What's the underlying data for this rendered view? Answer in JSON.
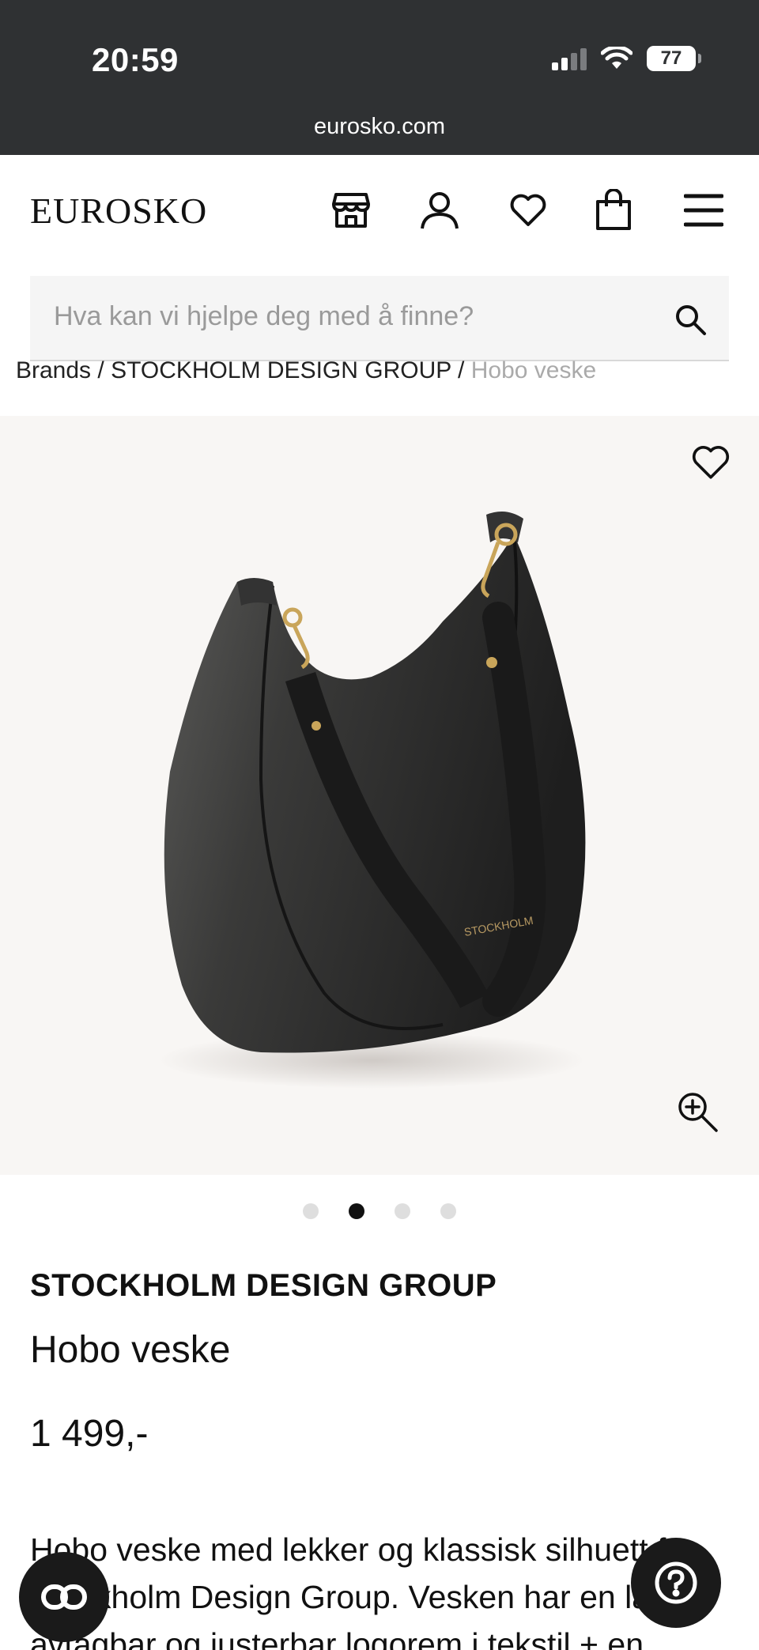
{
  "status_bar": {
    "time": "20:59",
    "battery": "77",
    "url": "eurosko.com"
  },
  "header": {
    "logo": "EUROSKO",
    "icons": [
      "store-icon",
      "user-icon",
      "heart-icon",
      "bag-icon",
      "menu-icon"
    ]
  },
  "search": {
    "placeholder": "Hva kan vi hjelpe deg med å finne?"
  },
  "breadcrumb": {
    "items": [
      "Brands",
      "STOCKHOLM DESIGN GROUP"
    ],
    "current": "Hobo veske",
    "separator": " / "
  },
  "gallery": {
    "slide_count": 4,
    "active_slide": 2,
    "bag_stamp": "STOCKHOLM"
  },
  "product": {
    "brand": "STOCKHOLM DESIGN GROUP",
    "name": "Hobo veske",
    "price": "1 499,-",
    "description": "Hobo veske med lekker og klassisk silhuett fra Stockholm Design Group. Vesken har en lang avtagbar og justerbar logorem i tekstil + en..."
  },
  "colors": {
    "status_bar_bg": "#2f3133",
    "gallery_bg": "#f8f6f4",
    "search_bg": "#f5f5f5",
    "fab_bg": "#1a1a1a"
  }
}
